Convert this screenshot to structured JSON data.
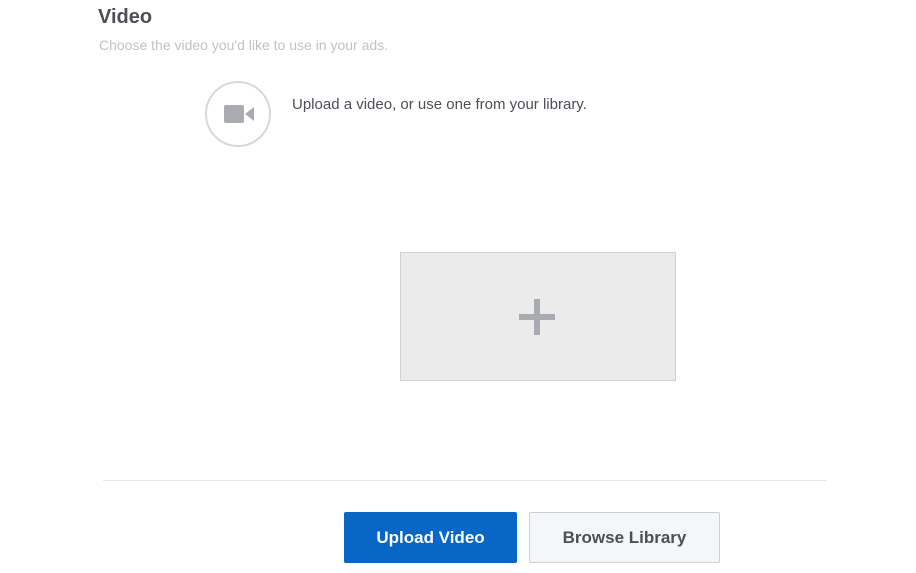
{
  "section": {
    "title": "Video",
    "subtitle": "Choose the video you'd like to use in your ads."
  },
  "upload_prompt": {
    "icon": "video-camera-icon",
    "text": "Upload a video, or use one from your library."
  },
  "add_tile": {
    "icon": "plus-icon"
  },
  "actions": {
    "upload_label": "Upload Video",
    "browse_label": "Browse Library"
  },
  "colors": {
    "primary": "#0866c7",
    "secondary_bg": "#f5f6f7",
    "icon_gray": "#a8abb0",
    "tile_bg": "#ebebec",
    "subtitle": "#bec2c9"
  }
}
